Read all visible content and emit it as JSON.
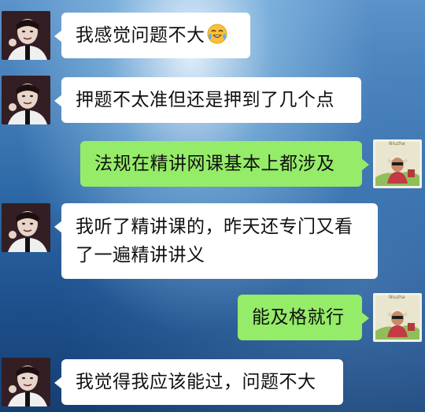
{
  "conversation": {
    "messages": [
      {
        "side": "left",
        "text": "我感觉问题不大",
        "emoji": "laughing-crying-emoji"
      },
      {
        "side": "left",
        "text": "押题不太准但还是押到了几个点"
      },
      {
        "side": "right",
        "text": "法规在精讲网课基本上都涉及"
      },
      {
        "side": "left",
        "line1": "我听了精讲课的，昨天还专门又看",
        "line2": "了一遍精讲讲义"
      },
      {
        "side": "right",
        "text": "能及格就行"
      },
      {
        "side": "left",
        "text": "我觉得我应该能过，问题不大"
      }
    ],
    "right_avatar_caption": "Niuzha"
  },
  "colors": {
    "incoming_bubble": "#ffffff",
    "outgoing_bubble": "#95ec69",
    "background_top": "#5b92c9",
    "background_bottom": "#163f73"
  }
}
